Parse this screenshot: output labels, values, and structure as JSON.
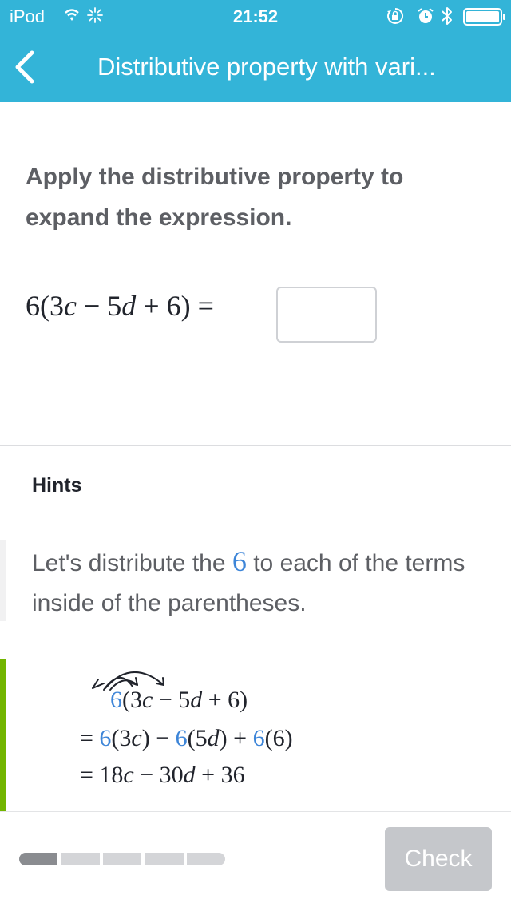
{
  "status_bar": {
    "carrier": "iPod",
    "time": "21:52",
    "icons": [
      "wifi-icon",
      "activity-icon",
      "orientation-lock-icon",
      "alarm-icon",
      "bluetooth-icon",
      "battery-icon"
    ]
  },
  "nav": {
    "back_icon": "chevron-left-icon",
    "title": "Distributive property with vari..."
  },
  "problem": {
    "prompt": "Apply the distributive property to expand the expression.",
    "expression": {
      "coef": "6",
      "term1": "3",
      "var1": "c",
      "op1": " − ",
      "term2": "5",
      "var2": "d",
      "op2": " + ",
      "term3": "6",
      "equals": " = "
    },
    "answer_value": ""
  },
  "hints": {
    "title": "Hints",
    "hint1_before": "Let's distribute the ",
    "hint1_highlight": "6",
    "hint1_after": " to each of the terms inside of the parentheses.",
    "work": {
      "line1": {
        "coef": "6",
        "rest_pre": "(3",
        "v1": "c",
        "mid1": " − 5",
        "v2": "d",
        "rest_post": " + 6)"
      },
      "line2": {
        "eq": "= ",
        "c1": "6",
        "p1": "(3",
        "v1": "c",
        "p1e": ") − ",
        "c2": "6",
        "p2": "(5",
        "v2": "d",
        "p2e": ") + ",
        "c3": "6",
        "p3": "(6)"
      },
      "line3": {
        "eq": "= ",
        "t1": "18",
        "v1": "c",
        "op1": " − 30",
        "v2": "d",
        "op2": " + 36"
      }
    }
  },
  "footer": {
    "progress": {
      "completed": 1,
      "total": 5
    },
    "check_label": "Check"
  },
  "colors": {
    "header": "#33b4d8",
    "highlight_blue": "#3d85d8",
    "hint_green": "#72b500",
    "check_disabled": "#c5c7cb"
  }
}
